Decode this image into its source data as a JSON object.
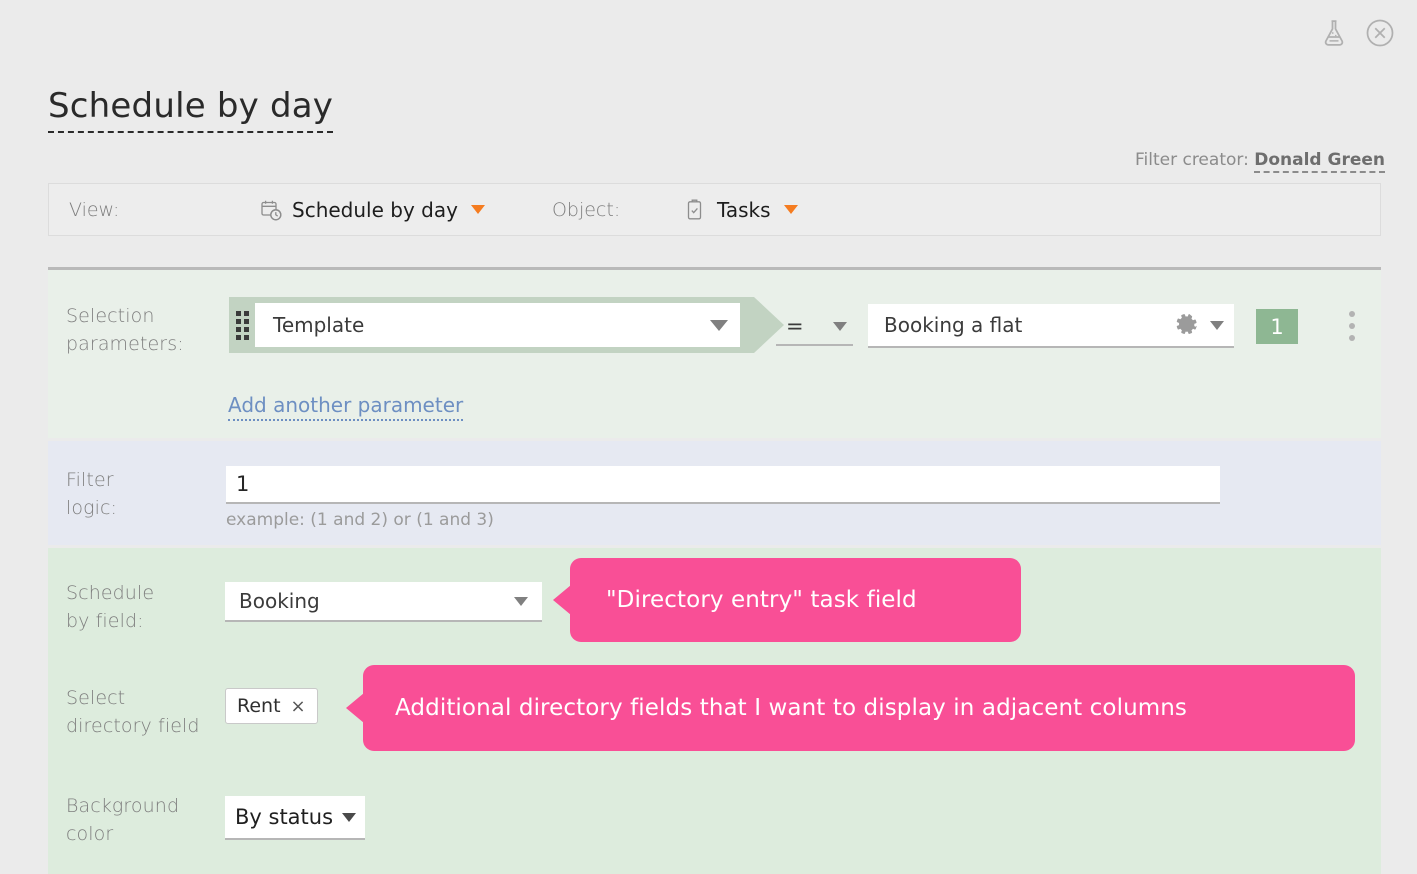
{
  "window": {
    "top_icons": [
      {
        "name": "flask-icon",
        "label": "Beta features"
      },
      {
        "name": "close-icon",
        "label": "Close"
      }
    ]
  },
  "header": {
    "title": "Schedule by day",
    "creator_label": "Filter creator:",
    "creator_name": "Donald Green"
  },
  "viewbar": {
    "view_label": "View:",
    "view_value": "Schedule by day",
    "view_icon": "calendar-clock-icon",
    "object_label": "Object:",
    "object_value": "Tasks",
    "object_icon": "clipboard-check-icon",
    "caret_color": "#f57c20"
  },
  "selection_parameters": {
    "label": "Selection\nparameters:",
    "label_line1": "Selection",
    "label_line2": "parameters:",
    "field": "Template",
    "operator": "=",
    "value": "Booking a flat",
    "gear_icon": "gear-icon",
    "badge": "1",
    "badge_color": "#8eb793",
    "add_link": "Add another parameter",
    "section_color": "#e9f0e9"
  },
  "filter_logic": {
    "label_line1": "Filter",
    "label_line2": "logic:",
    "value": "1",
    "placeholder": "",
    "hint": "example: (1 and 2) or (1 and 3)",
    "section_color": "#e6e9f2"
  },
  "display": {
    "section_color": "#ddecdd",
    "schedule_by_field": {
      "label_line1": "Schedule",
      "label_line2": "by field:",
      "value": "Booking"
    },
    "select_directory_field": {
      "label_line1": "Select",
      "label_line2": "directory field",
      "chip": "Rent",
      "chip_remove": "×"
    },
    "background_color_field": {
      "label_line1": "Background",
      "label_line2": "color",
      "value": "By status"
    }
  },
  "callouts": [
    {
      "text": "\"Directory entry\" task field",
      "color": "#f94f96"
    },
    {
      "text": "Additional directory fields that I want to display in adjacent columns",
      "color": "#f94f96"
    }
  ]
}
